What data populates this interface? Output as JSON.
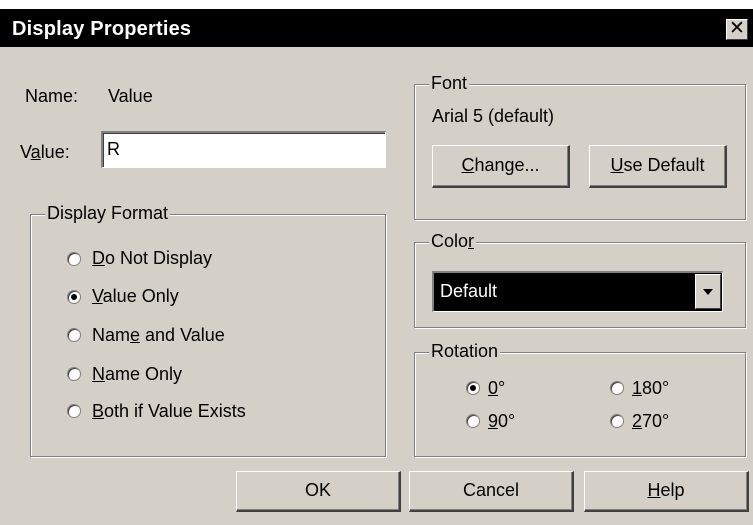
{
  "window": {
    "title": "Display Properties",
    "close_glyph": "✕"
  },
  "name_row": {
    "label": "Name:",
    "value": "Value"
  },
  "value_row": {
    "label_pre": "V",
    "label_ul": "a",
    "label_post": "lue:",
    "value": "R"
  },
  "display_format": {
    "legend": "Display Format",
    "options": [
      {
        "pre": "",
        "ul": "D",
        "post": "o Not Display",
        "checked": false
      },
      {
        "pre": "",
        "ul": "V",
        "post": "alue Only",
        "checked": true
      },
      {
        "pre": "Nam",
        "ul": "e",
        "post": " and Value",
        "checked": false
      },
      {
        "pre": "",
        "ul": "N",
        "post": "ame Only",
        "checked": false
      },
      {
        "pre": "",
        "ul": "B",
        "post": "oth if Value Exists",
        "checked": false
      }
    ]
  },
  "font": {
    "legend": "Font",
    "current": "Arial 5 (default)",
    "change_pre": "",
    "change_ul": "C",
    "change_post": "hange...",
    "default_pre": "",
    "default_ul": "U",
    "default_post": "se Default"
  },
  "color": {
    "legend_pre": "Colo",
    "legend_ul": "r",
    "legend_post": "",
    "selected": "Default"
  },
  "rotation": {
    "legend": "Rotation",
    "options": [
      {
        "ul": "0",
        "post": "°",
        "checked": true
      },
      {
        "ul": "1",
        "post": "80°",
        "checked": false
      },
      {
        "ul": "9",
        "post": "0°",
        "checked": false
      },
      {
        "ul": "2",
        "post": "70°",
        "checked": false
      }
    ]
  },
  "buttons": {
    "ok": "OK",
    "cancel": "Cancel",
    "help_pre": "",
    "help_ul": "H",
    "help_post": "elp"
  }
}
